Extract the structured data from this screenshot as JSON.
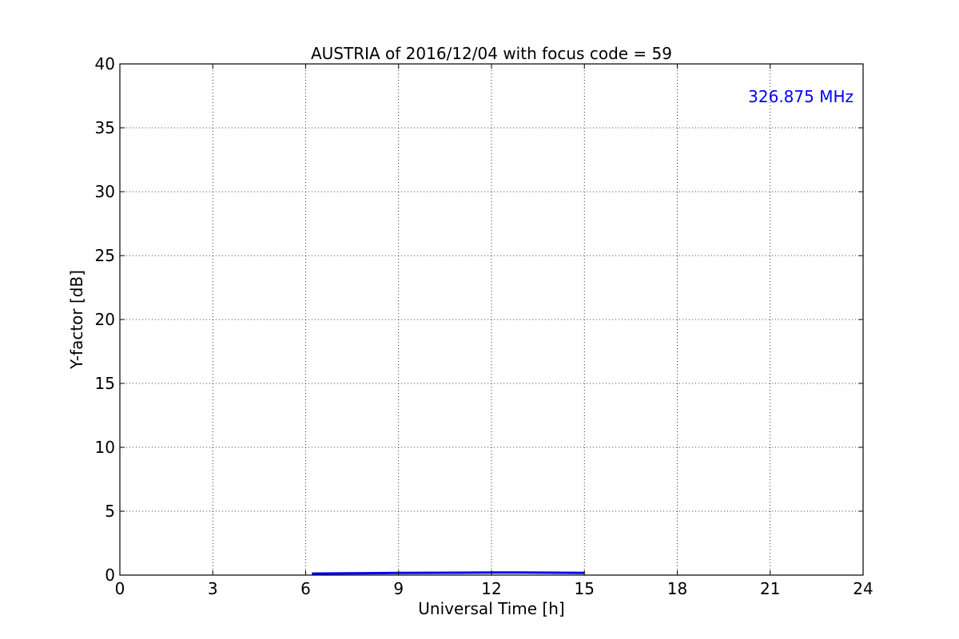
{
  "chart_data": {
    "type": "line",
    "title": "AUSTRIA of 2016/12/04 with focus code = 59",
    "xlabel": "Universal Time [h]",
    "ylabel": "Y-factor [dB]",
    "xlim": [
      0,
      24
    ],
    "ylim": [
      0,
      40
    ],
    "xticks": [
      0,
      3,
      6,
      9,
      12,
      15,
      18,
      21,
      24
    ],
    "yticks": [
      0,
      5,
      10,
      15,
      20,
      25,
      30,
      35,
      40
    ],
    "xtick_labels": [
      "0",
      "3",
      "6",
      "9",
      "12",
      "15",
      "18",
      "21",
      "24"
    ],
    "ytick_labels": [
      "0",
      "5",
      "10",
      "15",
      "20",
      "25",
      "30",
      "35",
      "40"
    ],
    "grid": true,
    "annotation": {
      "text": "326.875 MHz",
      "color": "#0000ff",
      "placement": "top-right"
    },
    "series": [
      {
        "color": "#0000ff",
        "x": [
          6.2,
          7.0,
          8.0,
          9.0,
          10.0,
          11.0,
          12.0,
          13.0,
          14.0,
          15.0
        ],
        "y": [
          0.12,
          0.13,
          0.15,
          0.17,
          0.18,
          0.19,
          0.2,
          0.2,
          0.19,
          0.17
        ]
      }
    ]
  }
}
